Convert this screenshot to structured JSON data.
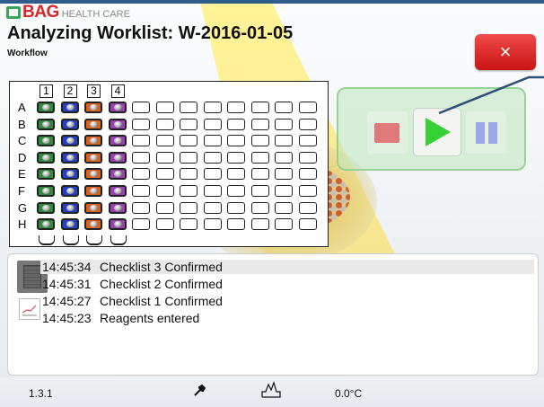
{
  "header": {
    "logo_text": "BAG",
    "logo_sub": "HEALTH CARE",
    "title": "Analyzing Worklist: W-2016-01-05",
    "subtitle": "Workflow",
    "close_label": "×"
  },
  "plate": {
    "column_headers": [
      "1",
      "2",
      "3",
      "4"
    ],
    "row_labels": [
      "A",
      "B",
      "C",
      "D",
      "E",
      "F",
      "G",
      "H"
    ],
    "filled_columns": [
      {
        "column": "1",
        "color": "#2e8b3a"
      },
      {
        "column": "2",
        "color": "#2440c8"
      },
      {
        "column": "3",
        "color": "#e0601e"
      },
      {
        "column": "4",
        "color": "#9b3fb3"
      }
    ],
    "total_columns": 12
  },
  "controls": {
    "stop_icon": "stop-icon",
    "play_icon": "play-icon",
    "pause_icon": "pause-icon",
    "play_state": "active"
  },
  "log": {
    "entries": [
      {
        "time": "14:45:34",
        "text": "Checklist 3 Confirmed"
      },
      {
        "time": "14:45:31",
        "text": "Checklist 2 Confirmed"
      },
      {
        "time": "14:45:27",
        "text": "Checklist 1 Confirmed"
      },
      {
        "time": "14:45:23",
        "text": "Reagents entered"
      }
    ]
  },
  "status": {
    "version": "1.3.1",
    "temperature": "0.0°C",
    "wrench_icon": "wrench-icon",
    "graph_icon": "graph-icon"
  },
  "colors": {
    "accent_red": "#d92626",
    "logo_green": "#3aa655",
    "play_green": "#37d037"
  }
}
